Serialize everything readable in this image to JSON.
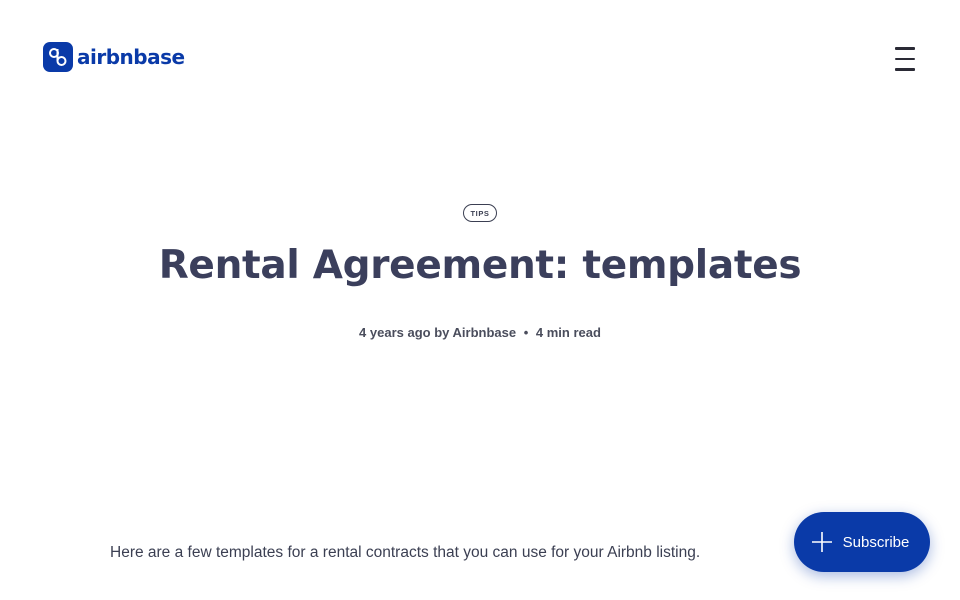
{
  "header": {
    "logo_text": "airbnbase",
    "menu_icon": "hamburger-menu-icon"
  },
  "article": {
    "tag": "TIPS",
    "title": "Rental Agreement: templates",
    "meta": {
      "time_ago": "4 years ago by",
      "author": "Airbnbase",
      "separator": "•",
      "read_time": "4 min read"
    },
    "intro": "Here are a few templates for a rental contracts that you can use for your Airbnb listing."
  },
  "subscribe": {
    "label": "Subscribe",
    "icon": "plus-icon"
  },
  "colors": {
    "brand": "#0a3aa8",
    "text": "#3b3f52"
  }
}
